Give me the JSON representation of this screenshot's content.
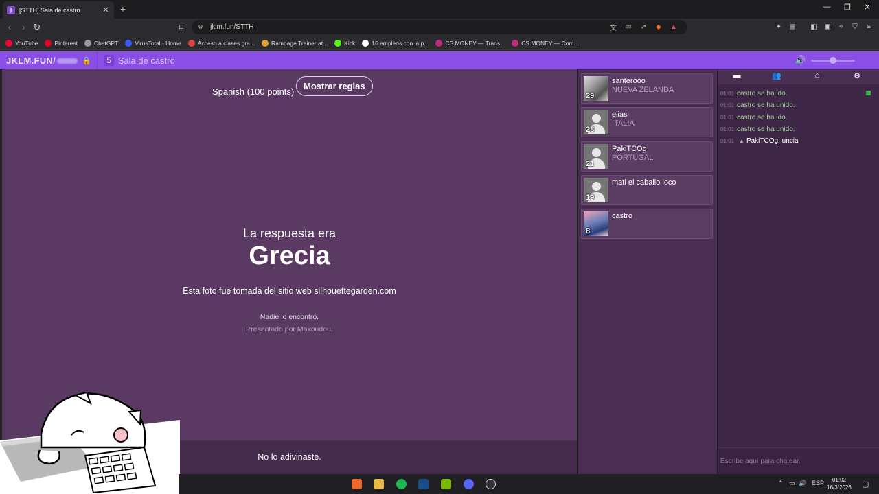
{
  "browser": {
    "tab_title": "[STTH] Sala de castro",
    "tab_favicon": "jklm-favicon",
    "url": "jklm.fun/STTH",
    "bookmarks": [
      {
        "label": "YouTube",
        "color": "#ff0033"
      },
      {
        "label": "Pinterest",
        "color": "#e60023"
      },
      {
        "label": "ChatGPT",
        "color": "#9a9a9a"
      },
      {
        "label": "VirusTotal - Home",
        "color": "#3d5afe"
      },
      {
        "label": "Acceso a clases gra...",
        "color": "#d44"
      },
      {
        "label": "Rampage Trainer at...",
        "color": "#e0a030"
      },
      {
        "label": "Kick",
        "color": "#53fc18"
      },
      {
        "label": "16 empleos con la p...",
        "color": "#fff"
      },
      {
        "label": "CS.MONEY — Trans...",
        "color": "#c22b7a"
      },
      {
        "label": "CS.MONEY — Com...",
        "color": "#c22b7a"
      }
    ]
  },
  "header": {
    "brand": "JKLM.FUN/",
    "room_count": "5",
    "room_name": "Sala de castro"
  },
  "game": {
    "language_label": "Spanish (100 points)",
    "rules_button": "Mostrar reglas",
    "answer_prefix": "La respuesta era",
    "answer": "Grecia",
    "source": "Esta foto fue tomada del sitio web silhouettegarden.com",
    "nobody_found": "Nadie lo encontró.",
    "presented_by": "Presentado por Maxoudou.",
    "result": "No lo adivinaste."
  },
  "players": [
    {
      "name": "santerooo",
      "country": "NUEVA ZELANDA",
      "score": "29",
      "avatar": "photo1"
    },
    {
      "name": "elias",
      "country": "ITALIA",
      "score": "28",
      "avatar": "default"
    },
    {
      "name": "PakiTCOg",
      "country": "PORTUGAL",
      "score": "21",
      "avatar": "default"
    },
    {
      "name": "mati el caballo loco",
      "country": "",
      "score": "19",
      "avatar": "default"
    },
    {
      "name": "castro",
      "country": "",
      "score": "8",
      "avatar": "photo2"
    }
  ],
  "chat": {
    "tabs": [
      "chat-icon",
      "players-icon",
      "home-icon",
      "settings-icon"
    ],
    "lines": [
      {
        "time": "01:01",
        "text": "castro se ha ido.",
        "kind": "system"
      },
      {
        "time": "01:01",
        "text": "castro se ha unido.",
        "kind": "system"
      },
      {
        "time": "01:01",
        "text": "castro se ha ido.",
        "kind": "system"
      },
      {
        "time": "01:01",
        "text": "castro se ha unido.",
        "kind": "system"
      },
      {
        "time": "01:01",
        "text": "PakiTCOg: uncia",
        "kind": "user"
      }
    ],
    "input_placeholder": "Escribe aquí para chatear."
  },
  "taskbar": {
    "lang": "ESP",
    "time": "01:02",
    "date": "16/3/2026"
  }
}
